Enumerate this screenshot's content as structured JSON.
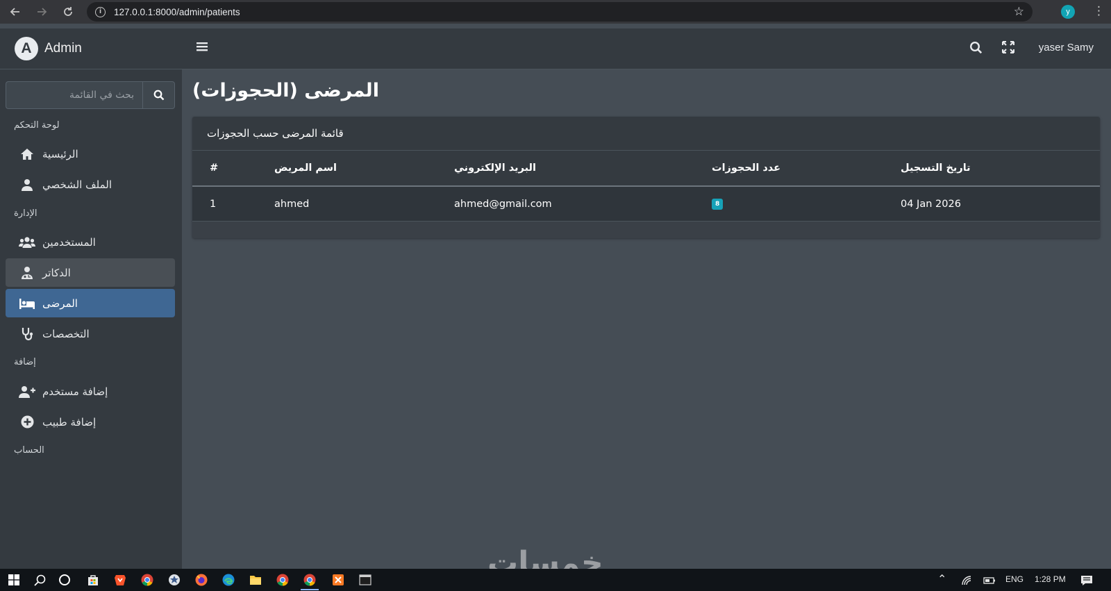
{
  "browser": {
    "url": "127.0.0.1:8000/admin/patients",
    "profile_initial": "y"
  },
  "sidebar": {
    "brand_logo": "A",
    "brand": "Admin",
    "search_placeholder": "بحث في القائمة",
    "sections": {
      "dashboard": "لوحة التحكم",
      "management": "الإدارة",
      "add": "إضافة",
      "account": "الحساب"
    },
    "items": {
      "home": "الرئيسية",
      "profile": "الملف الشخصي",
      "users": "المستخدمين",
      "doctors": "الدكاتر",
      "patients": "المرضى",
      "specialties": "التخصصات",
      "add_user": "إضافة مستخدم",
      "add_doctor": "إضافة طبيب"
    }
  },
  "navbar": {
    "user_name": "yaser Samy"
  },
  "page": {
    "title": "المرضى (الحجوزات)",
    "card_title": "قائمة المرضى حسب الحجوزات"
  },
  "table": {
    "headers": {
      "num": "#",
      "name": "اسم المريض",
      "email": "البريد الإلكتروني",
      "count": "عدد الحجوزات",
      "date": "تاريخ التسجيل"
    },
    "rows": [
      {
        "num": "1",
        "name": "ahmed",
        "email": "ahmed@gmail.com",
        "count": "8",
        "date": "04 Jan 2026"
      }
    ]
  },
  "watermark": "خمسات",
  "taskbar": {
    "lang": "ENG",
    "time": "1:28 PM"
  },
  "colors": {
    "sidebar_bg": "#343a40",
    "content_bg": "#454d55",
    "active_item": "#3f6793",
    "badge": "#17a2b8"
  }
}
